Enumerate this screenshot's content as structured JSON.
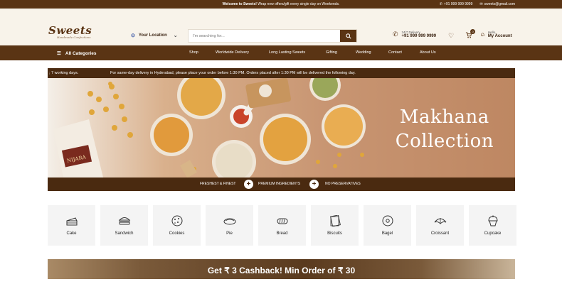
{
  "topbar": {
    "welcome_bold": "Welcome to Sweets!",
    "welcome_rest": " Wrap new offers/gift every single day on Weekends.",
    "phone": "+91 999 999 9999",
    "email": "sweets@gmail.com"
  },
  "header": {
    "logo_text": "Sweets",
    "logo_tagline": "Handmade Confections",
    "location_label": "Your Location",
    "search_placeholder": "I'm searching for...",
    "delivery_label": "24/7 Delivery",
    "delivery_number": "+91 999 999 9999",
    "cart_count": "0",
    "account_greeting": "Hello,",
    "account_label": "My Account"
  },
  "nav": {
    "all_categories": "All Categories",
    "links": [
      "Shop",
      "Worldwide Delivery",
      "Long Lasting Sweets",
      "Gifting",
      "Wedding",
      "Contact",
      "About Us"
    ]
  },
  "ticker": {
    "left_fragment": "; 7 working days.",
    "message": "For same-day delivery in Hyderabad, please place your order before 1:30 PM. Orders placed after 1:30 PM will be delivered the following day."
  },
  "banner": {
    "line1": "Makhana",
    "line2": "Collection",
    "pouch_label": "NIJARA"
  },
  "features": [
    "FRESHEST & FINEST",
    "PREMIUM INGREDIENTS",
    "NO PRESERVATIVES"
  ],
  "categories": [
    {
      "label": "Cake",
      "icon": "cake-icon"
    },
    {
      "label": "Sandwich",
      "icon": "sandwich-icon"
    },
    {
      "label": "Cookies",
      "icon": "cookie-icon"
    },
    {
      "label": "Pie",
      "icon": "pie-icon"
    },
    {
      "label": "Bread",
      "icon": "bread-icon"
    },
    {
      "label": "Biscuits",
      "icon": "biscuit-icon"
    },
    {
      "label": "Bagel",
      "icon": "bagel-icon"
    },
    {
      "label": "Croissant",
      "icon": "croissant-icon"
    },
    {
      "label": "Cupcake",
      "icon": "cupcake-icon"
    }
  ],
  "promo": {
    "cashback": "Get ₹ 3 Cashback! Min Order of ₹ 30"
  },
  "colors": {
    "brand": "#5a3414",
    "header_bg": "#f8f3ea",
    "tile_bg": "#f4f4f4"
  }
}
